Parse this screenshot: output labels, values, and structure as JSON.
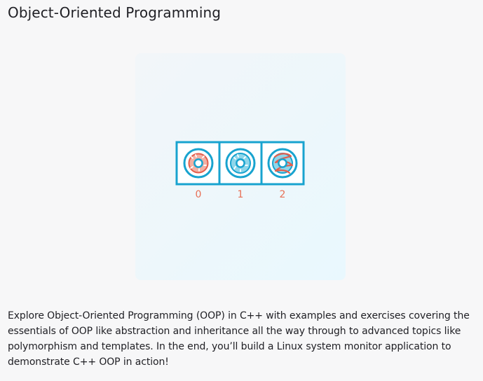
{
  "header": {
    "title": "Object-Oriented Programming"
  },
  "illustration": {
    "icons": [
      "donut-with-pink-frosting-icon",
      "donut-with-blue-frosting-icon",
      "donut-with-red-stripes-icon"
    ],
    "indices": [
      "0",
      "1",
      "2"
    ],
    "colors": {
      "border": "#18a3cf",
      "index_label": "#e86f55",
      "donut_light": "#8fd6ea",
      "frosting_pink": "#f3b0a3",
      "stripe_red": "#e45e4c"
    }
  },
  "content": {
    "description": "Explore Object-Oriented Programming (OOP) in C++ with examples and exercises covering the essentials of OOP like abstraction and inheritance all the way through to advanced topics like polymorphism and templates. In the end, you’ll build a Linux system monitor application to demonstrate C++ OOP in action!"
  }
}
